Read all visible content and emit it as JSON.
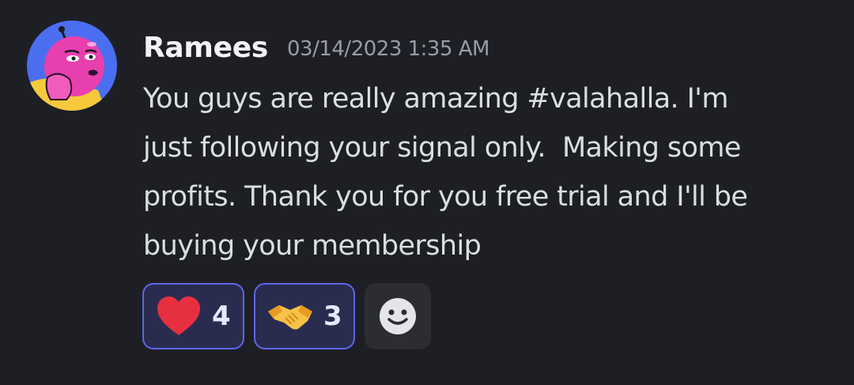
{
  "message": {
    "author": "Ramees",
    "timestamp": "03/14/2023 1:35 AM",
    "text": "You guys are really amazing #valahalla. I'm\njust following your signal only.  Making some\nprofits. Thank you for you free trial and I'll be\nbuying your membership"
  },
  "reactions": [
    {
      "emoji": "red-heart",
      "count": "4"
    },
    {
      "emoji": "handshake",
      "count": "3"
    }
  ],
  "add_reaction": {
    "icon": "smiley-face-icon"
  },
  "colors": {
    "background": "#1e1f25",
    "reaction_bg": "#292c4f",
    "reaction_border": "#5c67e8",
    "heart": "#e7303f",
    "handshake": "#f6c247"
  }
}
